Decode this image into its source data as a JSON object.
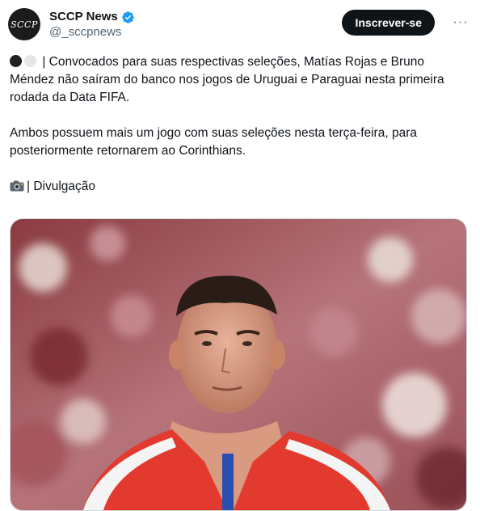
{
  "author": {
    "avatar_text": "SCCP",
    "display_name": "SCCP News",
    "handle": "@_sccpnews",
    "verified_icon": "verified-badge-icon",
    "subscribe_label": "Inscrever-se",
    "more_label": "···"
  },
  "tweet": {
    "paragraph1": "| Convocados para suas respectivas seleções, Matías Rojas e Bruno Méndez não saíram do banco nos jogos de Uruguai e Paraguai nesta primeira rodada da Data FIFA.",
    "paragraph2": "Ambos possuem mais um jogo com suas seleções nesta terça-feira, para posteriormente retornarem ao Corinthians.",
    "credit": "| Divulgação"
  },
  "colors": {
    "subscribe_bg": "#0f1419",
    "verified": "#1d9bf0",
    "handle": "#536471"
  }
}
